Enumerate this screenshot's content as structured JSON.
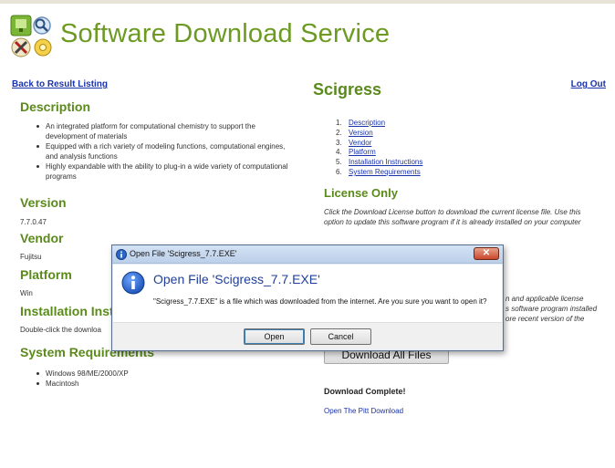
{
  "header": {
    "site_title": "Software Download Service",
    "back_link": "Back to Result Listing",
    "logout_link": "Log Out"
  },
  "product": {
    "name": "Scigress"
  },
  "left": {
    "description_heading": "Description",
    "description_items": [
      "An integrated platform for computational chemistry to support the development of materials",
      "Equipped with a rich variety of modeling functions, computational engines, and analysis functions",
      "Highly expandable with the ability to plug-in a wide variety of computational programs"
    ],
    "version_heading": "Version",
    "version_value": "7.7.0.47",
    "vendor_heading": "Vendor",
    "vendor_value": "Fujitsu",
    "platform_heading": "Platform",
    "platform_value": "Win",
    "install_heading": "Installation Instr",
    "install_value": "Double-click the downloa",
    "sysreq_heading": "System Requirements",
    "sysreq_items": [
      "Windows 98/ME/2000/XP",
      "Macintosh"
    ]
  },
  "toc": [
    {
      "num": "1.",
      "label": "Description"
    },
    {
      "num": "2.",
      "label": "Version"
    },
    {
      "num": "3.",
      "label": "Vendor"
    },
    {
      "num": "4.",
      "label": "Platform"
    },
    {
      "num": "5.",
      "label": "Installation Instructions"
    },
    {
      "num": "6.",
      "label": "System Requirements"
    }
  ],
  "license": {
    "heading": "License Only",
    "text": "Click the Download License button to download the current license file. Use this option to update this software program if it is already installed on your computer",
    "partial_text_lines": [
      "n and applicable license",
      "s software program installed",
      "ore recent version of the"
    ],
    "download_all_label": "Download All Files",
    "download_complete": "Download Complete!",
    "pitt_link": "Open The Pitt Download"
  },
  "dialog": {
    "title": "Open File 'Scigress_7.7.EXE'",
    "close_label": "✕",
    "heading": "Open File 'Scigress_7.7.EXE'",
    "message": "\"Scigress_7.7.EXE\" is a file which was downloaded from the internet. Are you sure you want to open it?",
    "open_label": "Open",
    "cancel_label": "Cancel"
  },
  "colors": {
    "brand_green": "#6c9a22",
    "link_blue": "#1a33aa",
    "dialog_heading": "#1e3f9a"
  }
}
